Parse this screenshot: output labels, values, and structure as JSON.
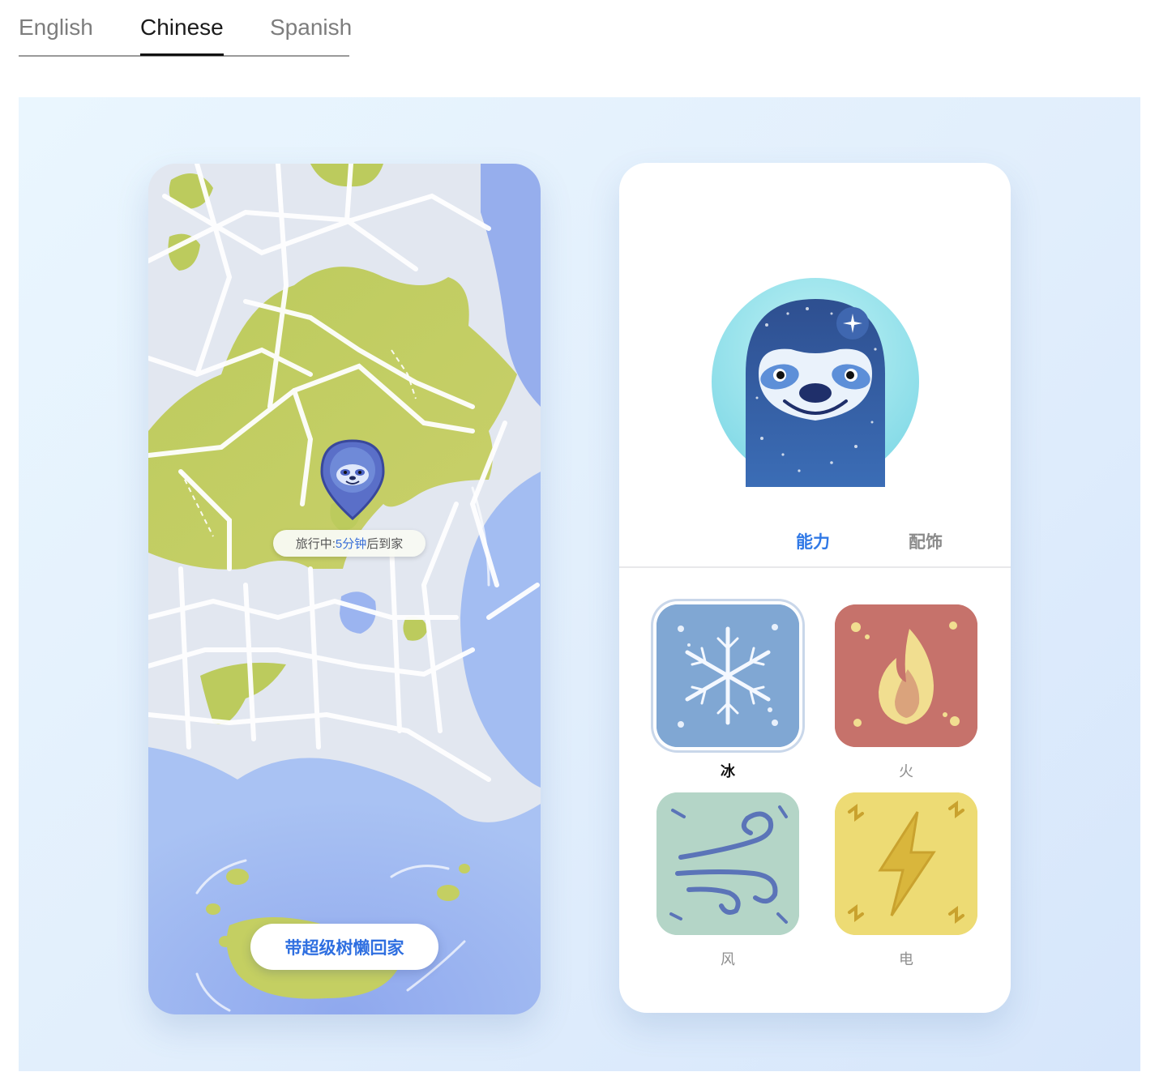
{
  "language_tabs": {
    "items": [
      {
        "label": "English"
      },
      {
        "label": "Chinese"
      },
      {
        "label": "Spanish"
      }
    ],
    "active": "Chinese"
  },
  "map_screen": {
    "status": {
      "prefix": "旅行中: ",
      "eta": "5分钟",
      "suffix": "后到家"
    },
    "cta_label": "带超级树懒回家"
  },
  "profile_screen": {
    "tabs": [
      {
        "label": "能力",
        "active": true
      },
      {
        "label": "配饰",
        "active": false
      }
    ],
    "abilities": [
      {
        "label": "冰",
        "icon": "snowflake-icon",
        "selected": true,
        "color": "#7ea6d4"
      },
      {
        "label": "火",
        "icon": "flame-icon",
        "selected": false,
        "color": "#c8756e"
      },
      {
        "label": "风",
        "icon": "wind-icon",
        "selected": false,
        "color": "#b2d3c6"
      },
      {
        "label": "电",
        "icon": "lightning-icon",
        "selected": false,
        "color": "#ecd974"
      }
    ]
  },
  "colors": {
    "accent": "#2f78e6",
    "land": "#c3ce63",
    "water": "#9ab5f0",
    "road": "#ffffff"
  }
}
